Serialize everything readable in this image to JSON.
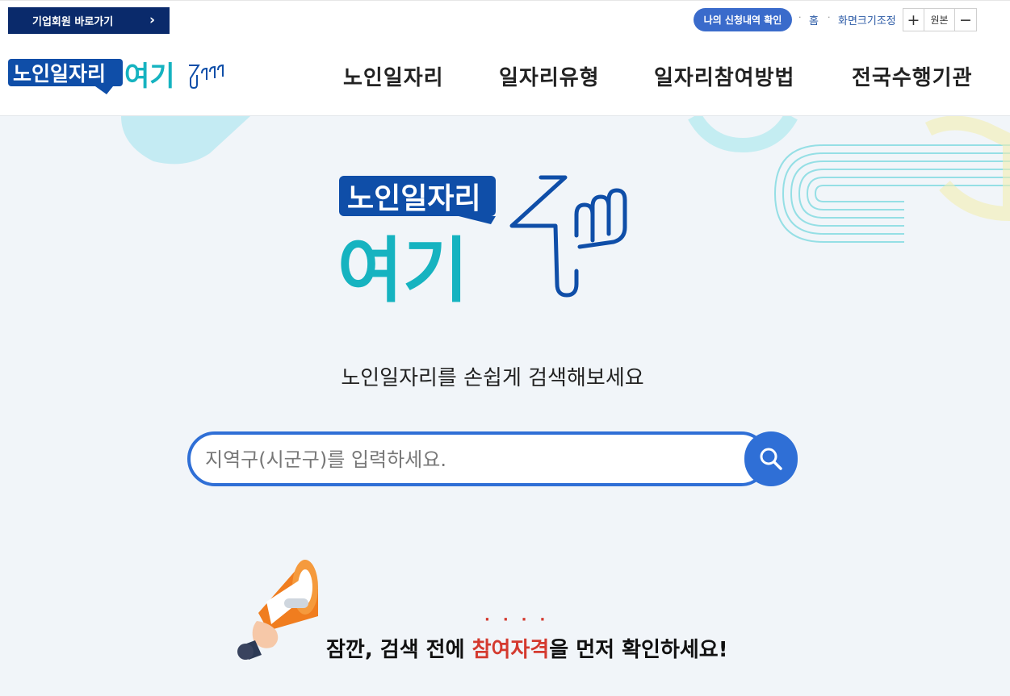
{
  "topbar": {
    "corp_link_label": "기업회원 바로가기",
    "apply_status_label": "나의 신청내역 확인",
    "home_label": "홈",
    "zoom_label": "화면크기조정",
    "zoom_in_symbol": "+",
    "zoom_reset_label": "원본",
    "zoom_out_symbol": "−"
  },
  "header": {
    "logo_top_text": "노인일자리",
    "logo_bottom_text": "여기",
    "nav": [
      "노인일자리",
      "일자리유형",
      "일자리참여방법",
      "전국수행기관"
    ]
  },
  "hero": {
    "logo_top_text": "노인일자리",
    "logo_bottom_text": "여기",
    "tagline": "노인일자리를 손쉽게 검색해보세요",
    "search_placeholder": "지역구(시군구)를 입력하세요.",
    "search_icon": "search-icon"
  },
  "notice": {
    "prefix": "잠깐, 검색 전에 ",
    "highlight": "참여자격",
    "suffix": "을 먼저 확인하세요!",
    "dots": "····",
    "icon": "megaphone-icon"
  },
  "colors": {
    "navy": "#0a2a6b",
    "brand_blue": "#2f6fd6",
    "brand_teal": "#16b3c0",
    "accent_red": "#d43a2f"
  }
}
